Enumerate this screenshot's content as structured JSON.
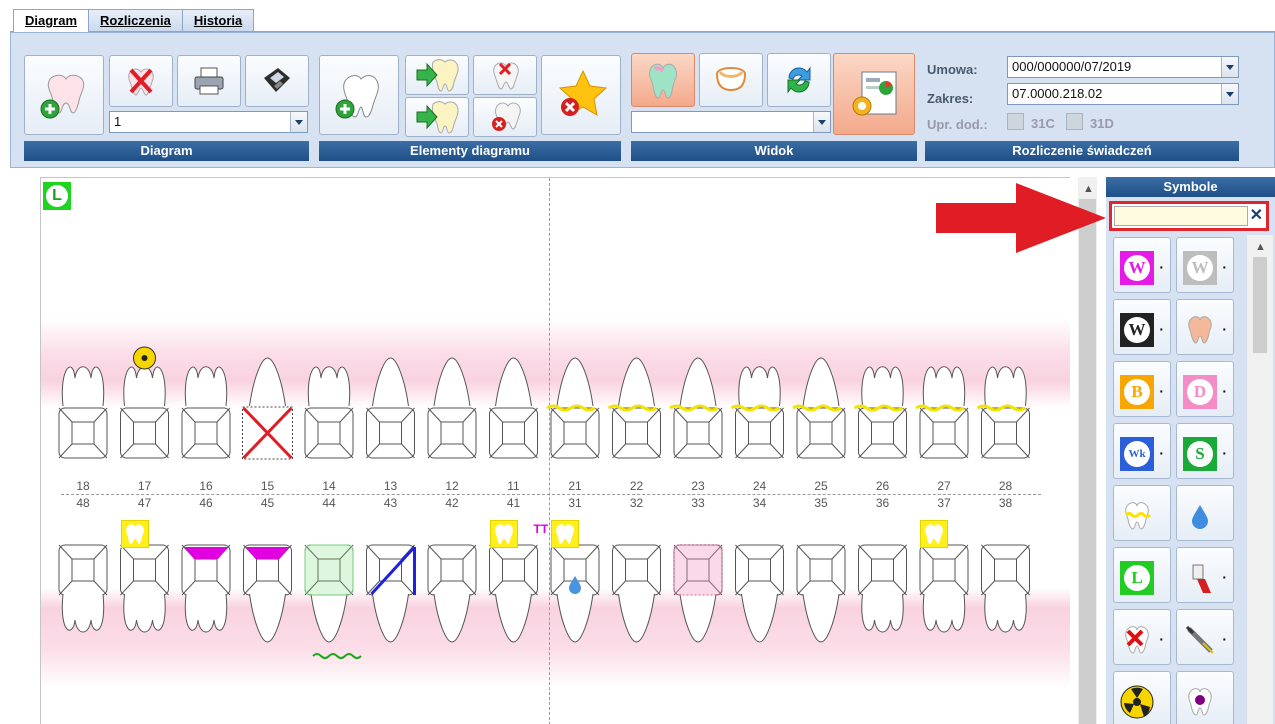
{
  "tabs": [
    {
      "label": "Diagram"
    },
    {
      "label": "Rozliczenia"
    },
    {
      "label": "Historia"
    }
  ],
  "ribbon": {
    "diagram_combo": "1",
    "view_combo": "",
    "groups": [
      "Diagram",
      "Elementy diagramu",
      "Widok",
      "Rozliczenie świadczeń"
    ],
    "settlement": {
      "umowa_label": "Umowa:",
      "umowa_value": "000/000000/07/2019",
      "zakres_label": "Zakres:",
      "zakres_value": "07.0000.218.02",
      "upr_label": "Upr. dod.:",
      "cb1": "31C",
      "cb2": "31D"
    }
  },
  "diagram": {
    "upper_numbers": [
      "18",
      "17",
      "16",
      "15",
      "14",
      "13",
      "12",
      "11",
      "21",
      "22",
      "23",
      "24",
      "25",
      "26",
      "27",
      "28"
    ],
    "lower_numbers": [
      "48",
      "47",
      "46",
      "45",
      "44",
      "43",
      "42",
      "41",
      "31",
      "32",
      "33",
      "34",
      "35",
      "36",
      "37",
      "38"
    ],
    "left_marker": "L"
  },
  "symbols": {
    "title": "Symbole",
    "search_value": "",
    "items": [
      {
        "name": "w-magenta",
        "letter": "W",
        "color": "#e61ae6"
      },
      {
        "name": "w-grey",
        "letter": "W",
        "color": "#bdbdbd"
      },
      {
        "name": "w-black",
        "letter": "W",
        "color": "#222"
      },
      {
        "name": "plaster",
        "letter": "",
        "color": "#f5b89a"
      },
      {
        "name": "b-orange",
        "letter": "B",
        "color": "#f7a600"
      },
      {
        "name": "d-pink",
        "letter": "D",
        "color": "#f48cc6"
      },
      {
        "name": "wk-blue",
        "letter": "Wk",
        "color": "#2a5fd9"
      },
      {
        "name": "s-green",
        "letter": "S",
        "color": "#1aaa3a"
      },
      {
        "name": "tooth-yellow",
        "letter": "",
        "color": "#ffee22"
      },
      {
        "name": "drop",
        "letter": "",
        "color": "#3d8ee0"
      },
      {
        "name": "l-green",
        "letter": "L",
        "color": "#22cc22"
      },
      {
        "name": "toothbrush",
        "letter": "",
        "color": "#d62020"
      },
      {
        "name": "tooth-x",
        "letter": "",
        "color": "#e01010"
      },
      {
        "name": "syringe",
        "letter": "",
        "color": "#777"
      },
      {
        "name": "radiation",
        "letter": "",
        "color": "#f7d600"
      },
      {
        "name": "skull-tooth",
        "letter": "",
        "color": "#800080"
      }
    ]
  }
}
